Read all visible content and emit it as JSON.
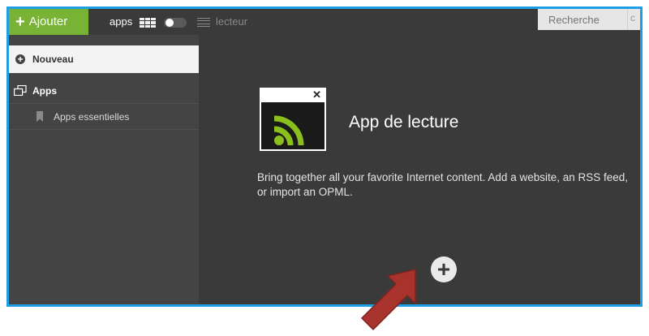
{
  "header": {
    "add_label": "Ajouter",
    "mode_apps_label": "apps",
    "mode_reader_label": "lecteur",
    "search_placeholder": "Recherche"
  },
  "sidebar": {
    "items": [
      {
        "label": "Nouveau",
        "icon": "plus-circle-icon"
      },
      {
        "label": "Apps",
        "icon": "windows-icon"
      },
      {
        "label": "Apps essentielles",
        "icon": "bookmark-icon"
      }
    ]
  },
  "main": {
    "app_title": "App de lecture",
    "app_icon": "rss-feed-icon",
    "description": "Bring together all your favorite Internet content. Add a website, an RSS feed, or import an OPML.",
    "add_icon": "plus-circle-icon"
  },
  "annotation": {
    "icon": "red-arrow-icon"
  },
  "colors": {
    "accent_green": "#78b336",
    "frame_blue": "#1e9ee6",
    "panel_dark": "#3a3a3a",
    "sidebar_dark": "#444444",
    "rss_green": "#8bbf1e",
    "arrow_red": "#a8322c"
  }
}
